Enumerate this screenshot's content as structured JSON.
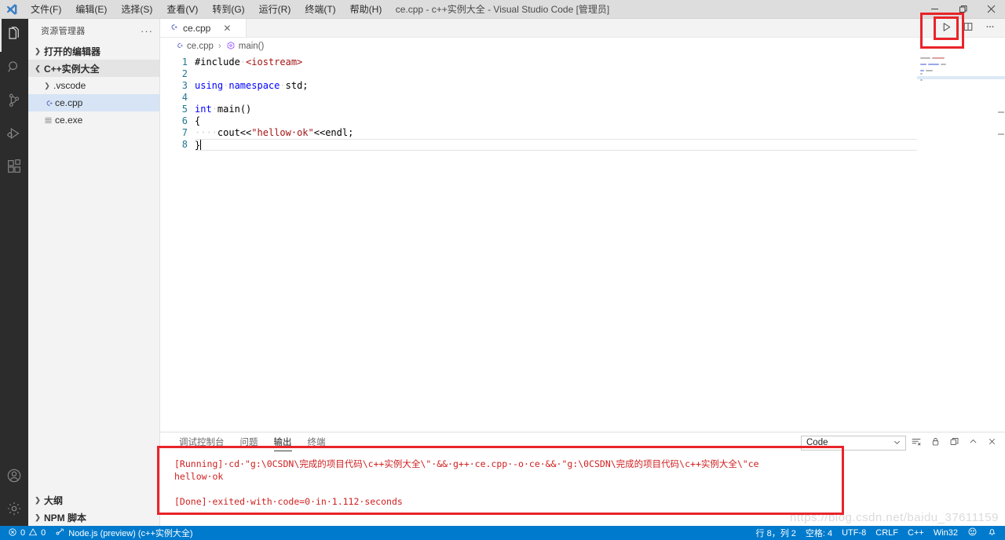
{
  "window": {
    "title": "ce.cpp - c++实例大全 - Visual Studio Code [管理员]",
    "minimize": "─",
    "restore": "❐",
    "close": "✕"
  },
  "menubar": {
    "items": [
      {
        "label": "文件(F)",
        "name": "menu-file"
      },
      {
        "label": "编辑(E)",
        "name": "menu-edit"
      },
      {
        "label": "选择(S)",
        "name": "menu-selection"
      },
      {
        "label": "查看(V)",
        "name": "menu-view"
      },
      {
        "label": "转到(G)",
        "name": "menu-goto"
      },
      {
        "label": "运行(R)",
        "name": "menu-run"
      },
      {
        "label": "终端(T)",
        "name": "menu-terminal"
      },
      {
        "label": "帮助(H)",
        "name": "menu-help"
      }
    ]
  },
  "activitybar": {
    "items": [
      {
        "icon": "explorer-icon",
        "active": true
      },
      {
        "icon": "search-icon",
        "active": false
      },
      {
        "icon": "source-control-icon",
        "active": false
      },
      {
        "icon": "run-debug-icon",
        "active": false
      },
      {
        "icon": "extensions-icon",
        "active": false
      }
    ],
    "bottom": [
      {
        "icon": "account-icon"
      },
      {
        "icon": "gear-icon"
      }
    ]
  },
  "sidebar": {
    "title": "资源管理器",
    "more": "···",
    "sections": [
      {
        "label": "打开的编辑器",
        "expanded": false
      },
      {
        "label": "C++实例大全",
        "expanded": true
      }
    ],
    "files": [
      {
        "label": ".vscode",
        "type": "folder",
        "selected": false
      },
      {
        "label": "ce.cpp",
        "type": "cpp",
        "selected": true
      },
      {
        "label": "ce.exe",
        "type": "binary",
        "selected": false
      }
    ],
    "bottom_sections": [
      {
        "label": "大纲"
      },
      {
        "label": "NPM 脚本"
      }
    ]
  },
  "editor": {
    "tab": {
      "label": "ce.cpp",
      "close": "✕"
    },
    "breadcrumb": {
      "file": "ce.cpp",
      "separator": "›",
      "symbol": "main()"
    },
    "actions": [
      {
        "name": "run-code-button",
        "icon": "play-icon",
        "highlighted": true
      },
      {
        "name": "split-editor-button",
        "icon": "split-editor-icon",
        "highlighted": false
      },
      {
        "name": "more-actions-button",
        "icon": "ellipsis-icon",
        "highlighted": false
      }
    ],
    "line_numbers": [
      "1",
      "2",
      "3",
      "4",
      "5",
      "6",
      "7",
      "8"
    ],
    "lines": [
      [
        {
          "t": "#include",
          "c": "plain"
        },
        {
          "t": "·",
          "c": "dot"
        },
        {
          "t": "<iostream>",
          "c": "inc"
        }
      ],
      [],
      [
        {
          "t": "using",
          "c": "kw"
        },
        {
          "t": "·",
          "c": "dot"
        },
        {
          "t": "namespace",
          "c": "kw"
        },
        {
          "t": "·",
          "c": "dot"
        },
        {
          "t": "std;",
          "c": "plain"
        }
      ],
      [],
      [
        {
          "t": "int",
          "c": "kw"
        },
        {
          "t": "·",
          "c": "dot"
        },
        {
          "t": "main()",
          "c": "plain"
        }
      ],
      [
        {
          "t": "{",
          "c": "plain"
        }
      ],
      [
        {
          "t": "····",
          "c": "dot"
        },
        {
          "t": "cout<<",
          "c": "plain"
        },
        {
          "t": "\"hellow·ok\"",
          "c": "str"
        },
        {
          "t": "<<endl;",
          "c": "plain"
        }
      ],
      [
        {
          "t": "}",
          "c": "plain"
        }
      ]
    ],
    "current_line_index": 7
  },
  "panel": {
    "tabs": [
      {
        "label": "调试控制台",
        "active": false
      },
      {
        "label": "问题",
        "active": false
      },
      {
        "label": "输出",
        "active": true
      },
      {
        "label": "终端",
        "active": false
      }
    ],
    "channel_select": {
      "value": "Code",
      "chevron": "⌄"
    },
    "actions": [
      {
        "name": "clear-output-button",
        "icon": "clear-output-icon"
      },
      {
        "name": "lock-scroll-button",
        "icon": "lock-icon"
      },
      {
        "name": "open-new-window-button",
        "icon": "new-window-icon"
      },
      {
        "name": "collapse-panel-button",
        "icon": "chevron-up-icon"
      },
      {
        "name": "close-panel-button",
        "icon": "close-icon"
      }
    ],
    "output_lines": [
      "[Running]·cd·\"g:\\0CSDN\\完成的项目代码\\c++实例大全\\\"·&&·g++·ce.cpp·-o·ce·&&·\"g:\\0CSDN\\完成的项目代码\\c++实例大全\\\"ce",
      "hellow·ok",
      "",
      "[Done]·exited·with·code=0·in·1.112·seconds"
    ]
  },
  "statusbar": {
    "errors": "0",
    "warnings": "0",
    "remote": "Node.js (preview) (c++实例大全)",
    "cursor": "行 8，列 2",
    "spaces": "空格: 4",
    "encoding": "UTF-8",
    "eol": "CRLF",
    "language": "C++",
    "platform": "Win32",
    "feedback_icon": "smiley-icon",
    "bell_icon": "bell-icon"
  },
  "watermark": "https://blog.csdn.net/baidu_37611159",
  "colors": {
    "accent": "#007acc",
    "highlight_box": "#e8242a",
    "terminal_text": "#cc0000",
    "sidebar_bg": "#f3f3f3",
    "activitybar_bg": "#2c2c2c"
  }
}
